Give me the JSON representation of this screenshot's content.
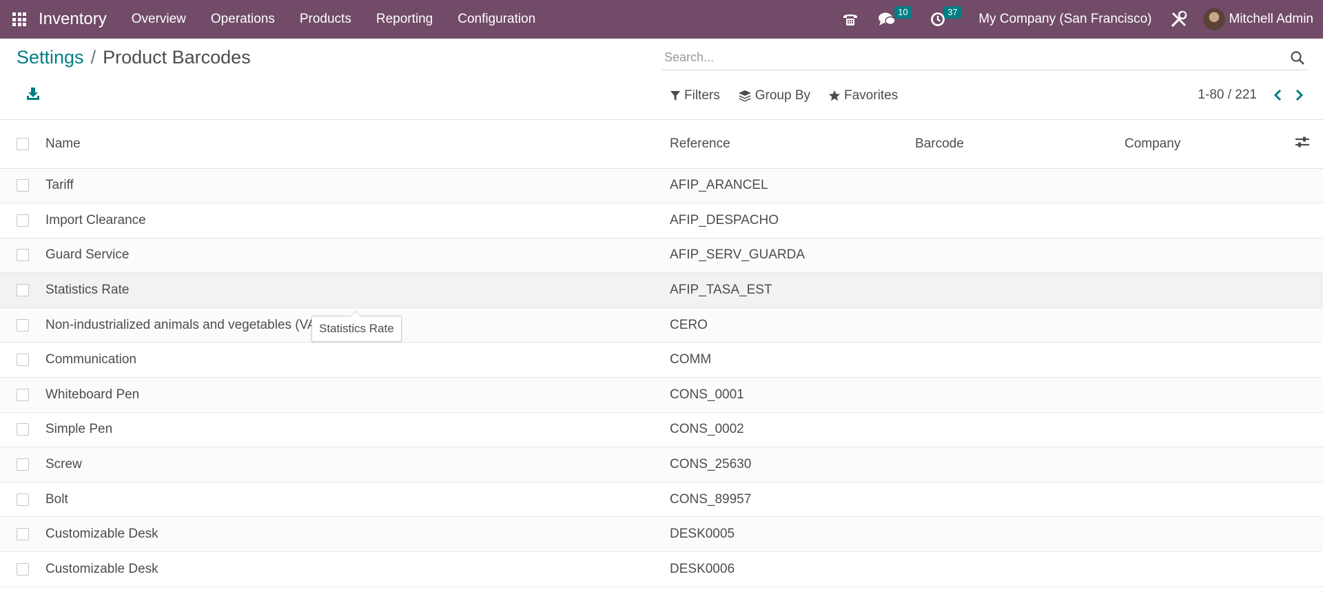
{
  "navbar": {
    "app_name": "Inventory",
    "menu": [
      "Overview",
      "Operations",
      "Products",
      "Reporting",
      "Configuration"
    ],
    "messages_count": "10",
    "activities_count": "37",
    "company": "My Company (San Francisco)",
    "user": "Mitchell Admin",
    "brand_color": "#714B67"
  },
  "breadcrumb": {
    "parent": "Settings",
    "separator": "/",
    "current": "Product Barcodes"
  },
  "search": {
    "placeholder": "Search...",
    "value": ""
  },
  "filters": {
    "filters_label": "Filters",
    "group_by_label": "Group By",
    "favorites_label": "Favorites"
  },
  "pager": {
    "value": "1-80 / 221"
  },
  "table": {
    "columns": [
      "Name",
      "Reference",
      "Barcode",
      "Company"
    ],
    "rows": [
      {
        "name": "Tariff",
        "reference": "AFIP_ARANCEL",
        "barcode": "",
        "company": ""
      },
      {
        "name": "Import Clearance",
        "reference": "AFIP_DESPACHO",
        "barcode": "",
        "company": ""
      },
      {
        "name": "Guard Service",
        "reference": "AFIP_SERV_GUARDA",
        "barcode": "",
        "company": ""
      },
      {
        "name": "Statistics Rate",
        "reference": "AFIP_TASA_EST",
        "barcode": "",
        "company": ""
      },
      {
        "name": "Non-industrialized animals and vegetables (VAT Exempt)",
        "reference": "CERO",
        "barcode": "",
        "company": ""
      },
      {
        "name": "Communication",
        "reference": "COMM",
        "barcode": "",
        "company": ""
      },
      {
        "name": "Whiteboard Pen",
        "reference": "CONS_0001",
        "barcode": "",
        "company": ""
      },
      {
        "name": "Simple Pen",
        "reference": "CONS_0002",
        "barcode": "",
        "company": ""
      },
      {
        "name": "Screw",
        "reference": "CONS_25630",
        "barcode": "",
        "company": ""
      },
      {
        "name": "Bolt",
        "reference": "CONS_89957",
        "barcode": "",
        "company": ""
      },
      {
        "name": "Customizable Desk",
        "reference": "DESK0005",
        "barcode": "",
        "company": ""
      },
      {
        "name": "Customizable Desk",
        "reference": "DESK0006",
        "barcode": "",
        "company": ""
      }
    ]
  },
  "tooltip": {
    "text": "Statistics Rate"
  }
}
